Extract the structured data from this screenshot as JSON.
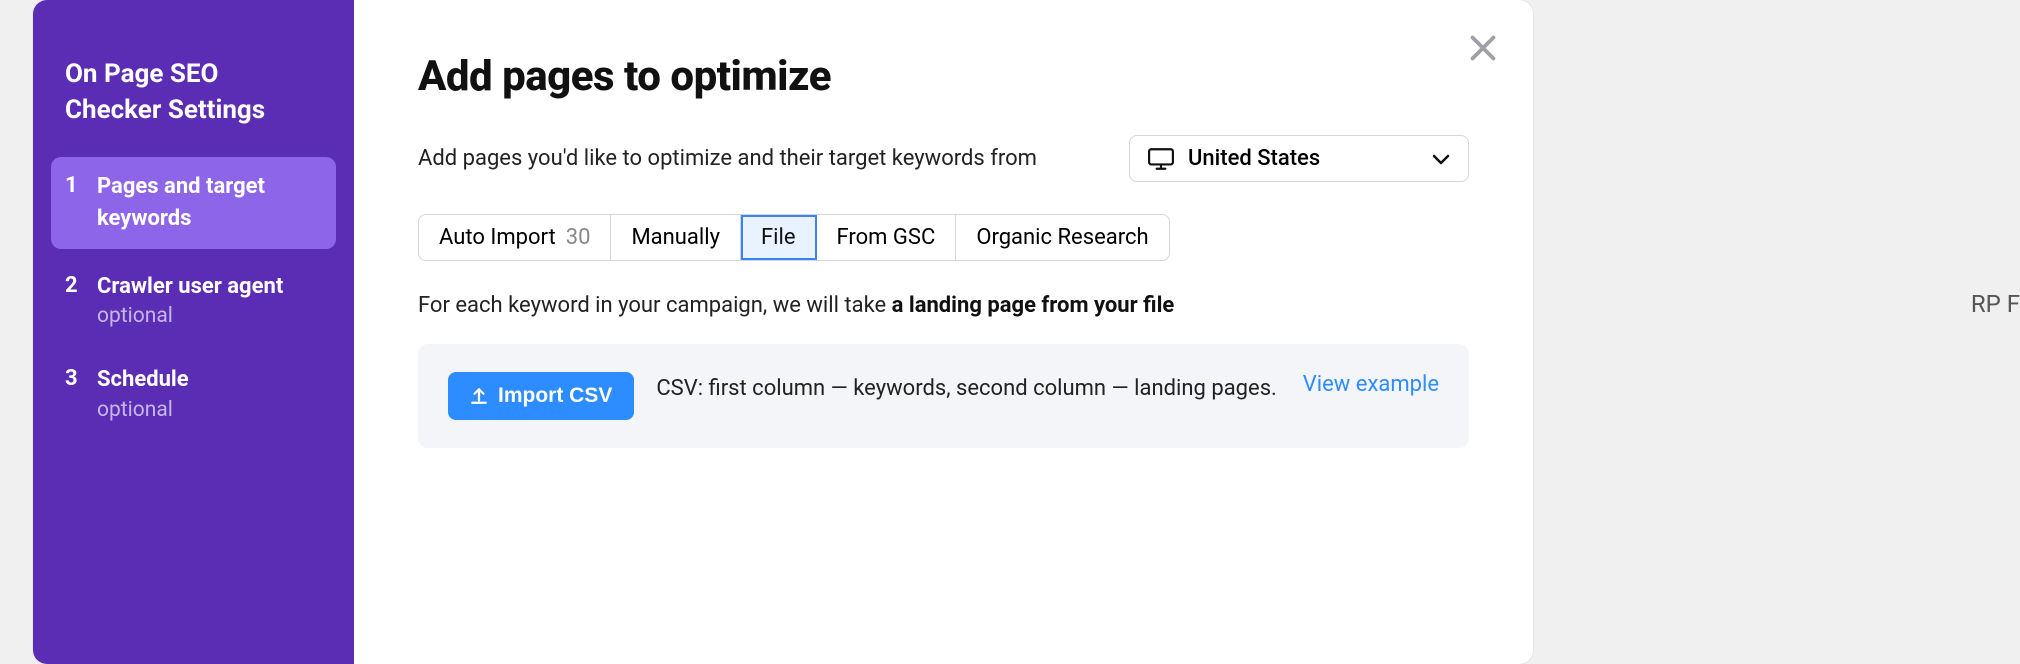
{
  "backdrop": {
    "hint_fragment": "RP F"
  },
  "sidebar": {
    "title_line1": "On Page SEO",
    "title_line2": "Checker Settings",
    "steps": [
      {
        "num": "1",
        "label": "Pages and target keywords",
        "optional": "",
        "active": true
      },
      {
        "num": "2",
        "label": "Crawler user agent",
        "optional": "optional",
        "active": false
      },
      {
        "num": "3",
        "label": "Schedule",
        "optional": "optional",
        "active": false
      }
    ]
  },
  "content": {
    "title": "Add pages to optimize",
    "desc": "Add pages you'd like to optimize and their target keywords from",
    "country": "United States",
    "tabs": [
      {
        "label": "Auto Import",
        "count": "30",
        "active": false
      },
      {
        "label": "Manually",
        "count": "",
        "active": false
      },
      {
        "label": "File",
        "count": "",
        "active": true
      },
      {
        "label": "From GSC",
        "count": "",
        "active": false
      },
      {
        "label": "Organic Research",
        "count": "",
        "active": false
      }
    ],
    "campaign_prefix": "For each keyword in your campaign, we will take ",
    "campaign_bold": "a landing page from your file",
    "import_button": "Import CSV",
    "import_desc": "CSV: first column — keywords, second column — landing pages.",
    "view_example": "View example"
  }
}
